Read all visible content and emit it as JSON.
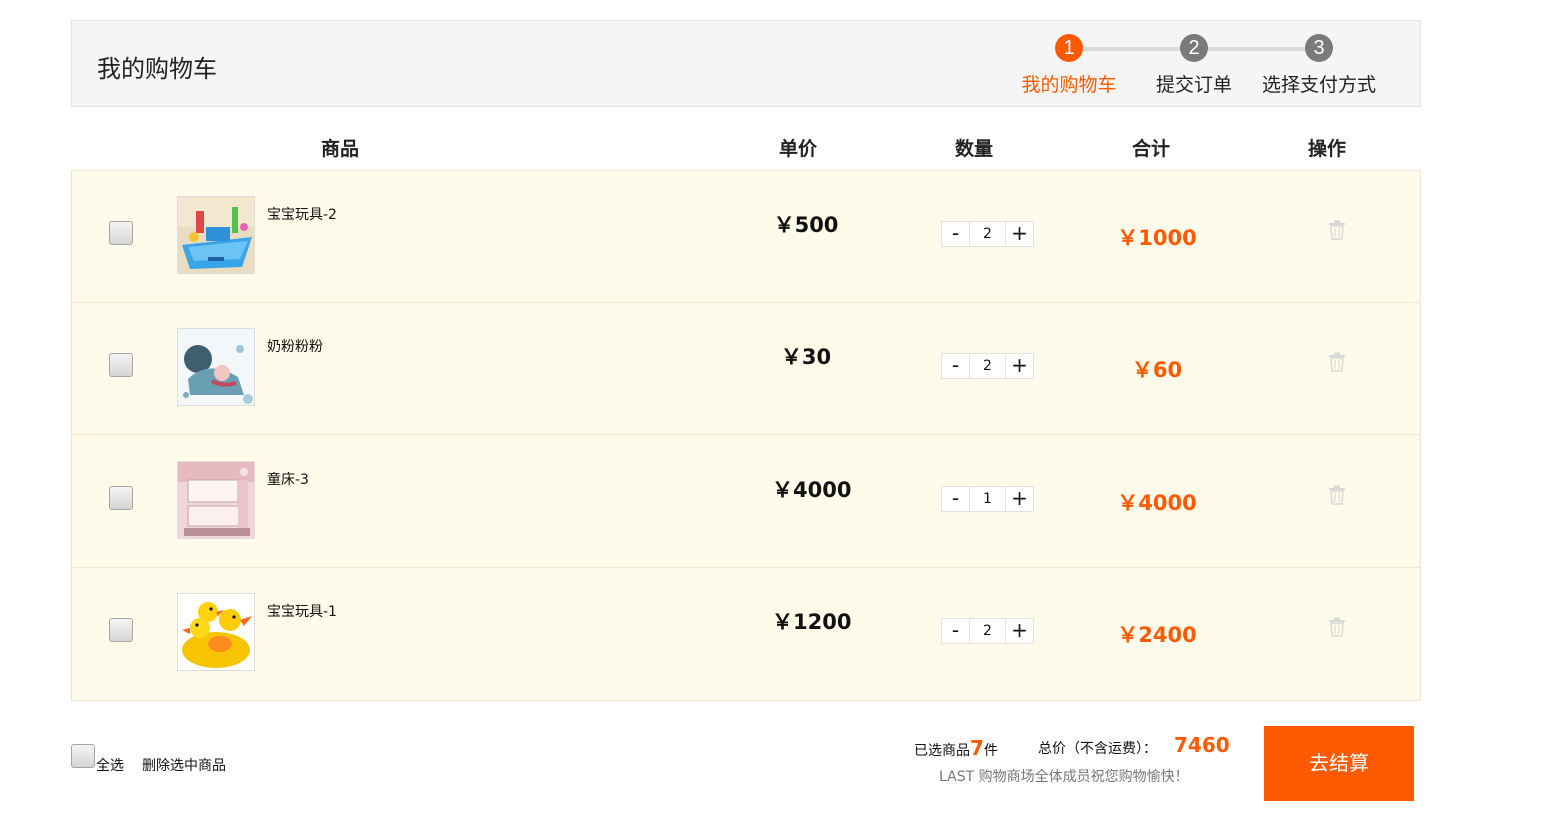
{
  "header": {
    "title": "我的购物车",
    "steps": [
      {
        "num": "1",
        "label": "我的购物车"
      },
      {
        "num": "2",
        "label": "提交订单"
      },
      {
        "num": "3",
        "label": "选择支付方式"
      }
    ]
  },
  "columns": {
    "product": "商品",
    "unit_price": "单价",
    "quantity": "数量",
    "subtotal": "合计",
    "action": "操作"
  },
  "items": [
    {
      "name": "宝宝玩具-2",
      "price": "￥500",
      "qty": "2",
      "subtotal": "￥1000"
    },
    {
      "name": "奶粉粉粉",
      "price": "￥30",
      "qty": "2",
      "subtotal": "￥60"
    },
    {
      "name": "童床-3",
      "price": "￥4000",
      "qty": "1",
      "subtotal": "￥4000"
    },
    {
      "name": "宝宝玩具-1",
      "price": "￥1200",
      "qty": "2",
      "subtotal": "￥2400"
    }
  ],
  "qty_controls": {
    "minus": "-",
    "plus": "+"
  },
  "footer": {
    "select_all": "全选",
    "delete_selected": "删除选中商品",
    "selected_prefix": "已选商品",
    "selected_count": "7",
    "selected_suffix": "件",
    "total_label": "总价（不含运费）：",
    "total_value": "7460",
    "slogan": "LAST 购物商场全体成员祝您购物愉快！",
    "checkout_label": "去结算"
  },
  "colors": {
    "accent": "#ff5a00",
    "row_bg": "#fefbea"
  }
}
